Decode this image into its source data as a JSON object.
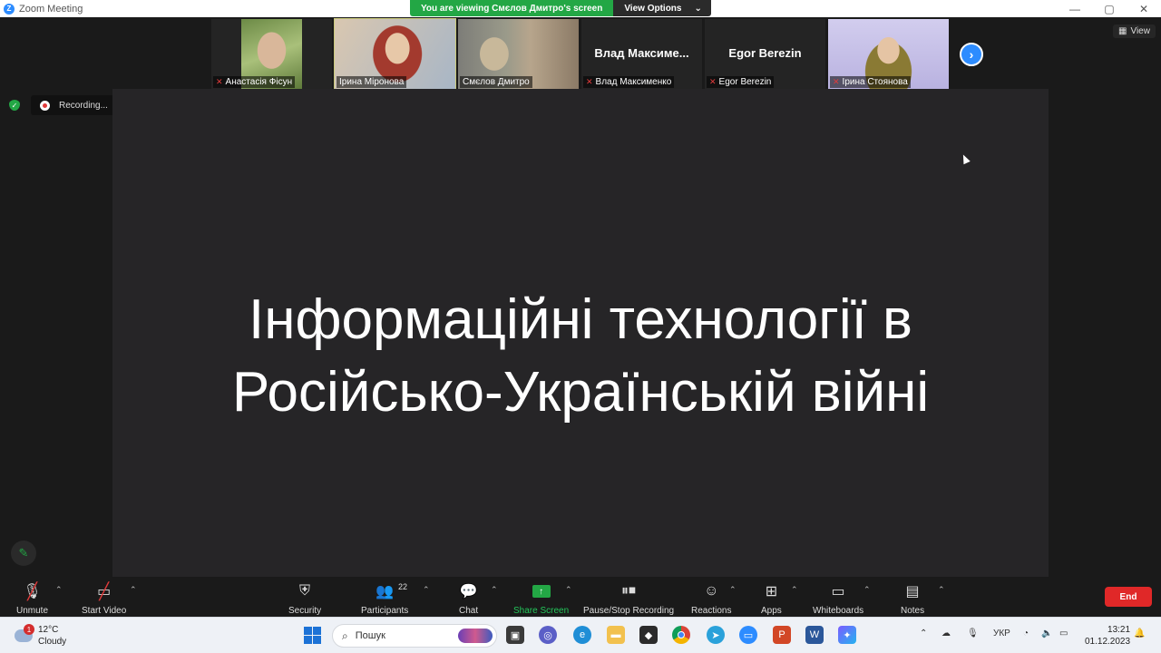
{
  "window": {
    "title": "Zoom Meeting",
    "controls": {
      "minimize": "—",
      "maximize": "▢",
      "close": "✕"
    }
  },
  "share_banner": {
    "text": "You are viewing Смєлов Дмитро's screen",
    "view_options_label": "View Options"
  },
  "participants_strip": [
    {
      "name": "Анастасія Фісун",
      "muted": true,
      "has_video": true,
      "photo_colors": [
        "#8aa35a",
        "#d9b79a"
      ]
    },
    {
      "name": "Ірина Міронова",
      "muted": false,
      "has_video": true,
      "photo_colors": [
        "#b04a3a",
        "#e7c8a8"
      ]
    },
    {
      "name": "Смєлов Дмитро",
      "muted": false,
      "has_video": true,
      "photo_colors": [
        "#9a9a8a",
        "#c8b89a"
      ]
    },
    {
      "name": "Влад Максименко",
      "display_name": "Влад Максиме...",
      "muted": true,
      "has_video": false
    },
    {
      "name": "Egor Berezin",
      "display_name": "Egor Berezin",
      "muted": true,
      "has_video": false
    },
    {
      "name": "Ірина Стоянова",
      "muted": true,
      "has_video": true,
      "photo_colors": [
        "#c6c0e6",
        "#7a6a3a"
      ]
    }
  ],
  "view_button_label": "View",
  "recording": {
    "label": "Recording..."
  },
  "slide": {
    "line1": "Інформаційні технології в",
    "line2": "Російсько-Українській війні"
  },
  "toolbar": {
    "unmute": "Unmute",
    "start_video": "Start Video",
    "security": "Security",
    "participants": "Participants",
    "participants_count": "22",
    "chat": "Chat",
    "share_screen": "Share Screen",
    "pause_stop_recording": "Pause/Stop Recording",
    "reactions": "Reactions",
    "apps": "Apps",
    "whiteboards": "Whiteboards",
    "notes": "Notes",
    "end": "End"
  },
  "taskbar": {
    "weather_temp": "12°C",
    "weather_desc": "Cloudy",
    "weather_badge": "1",
    "search_placeholder": "Пошук",
    "language": "УКР",
    "time": "13:21",
    "date": "01.12.2023"
  },
  "colors": {
    "zoom_blue": "#2d8cff",
    "share_green": "#23a745",
    "end_red": "#e02828",
    "slide_bg": "#262527"
  }
}
